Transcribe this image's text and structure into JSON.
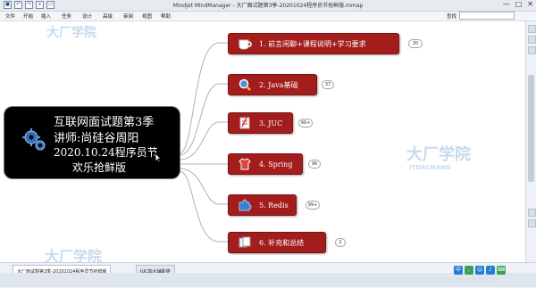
{
  "window": {
    "title": "Mindjet MindManager - 大厂面试题第3季-20201024程序员节抢鲜版.mmap",
    "controls": [
      "—",
      "□",
      "✕"
    ]
  },
  "menu": [
    "文件",
    "开始",
    "插入",
    "任务",
    "设计",
    "高级",
    "审阅",
    "视图",
    "帮助"
  ],
  "search_label": "查找",
  "central_topic": {
    "lines": [
      "互联网面试题第3季",
      "讲师:尚硅谷周阳",
      "2020.10.24程序员节",
      "欢乐抢鲜版"
    ],
    "icon": "gears-icon"
  },
  "topics": [
    {
      "label": "1. 前言闲聊+课程说明+学习要求",
      "badge": "20",
      "icon": "cup-icon"
    },
    {
      "label": "2. Java基础",
      "badge": "37",
      "icon": "magnifier-icon"
    },
    {
      "label": "3. JUC",
      "badge": "99+",
      "icon": "document-icon"
    },
    {
      "label": "4. Spring",
      "badge": "96",
      "icon": "shirt-icon"
    },
    {
      "label": "5. Redis",
      "badge": "99+",
      "icon": "puzzle-icon"
    },
    {
      "label": "6. 补充和总结",
      "badge": "2",
      "icon": "pages-icon"
    }
  ],
  "tabs": [
    "大厂面试题第3季-20201024程序员节抢鲜版",
    "JUC四大辅助类"
  ],
  "watermark": [
    "大厂学院",
    "ITDACHANG"
  ],
  "colors": {
    "topic_bg": "#a31d1d",
    "central_bg": "#000000",
    "accent": "#1f7fd4"
  }
}
